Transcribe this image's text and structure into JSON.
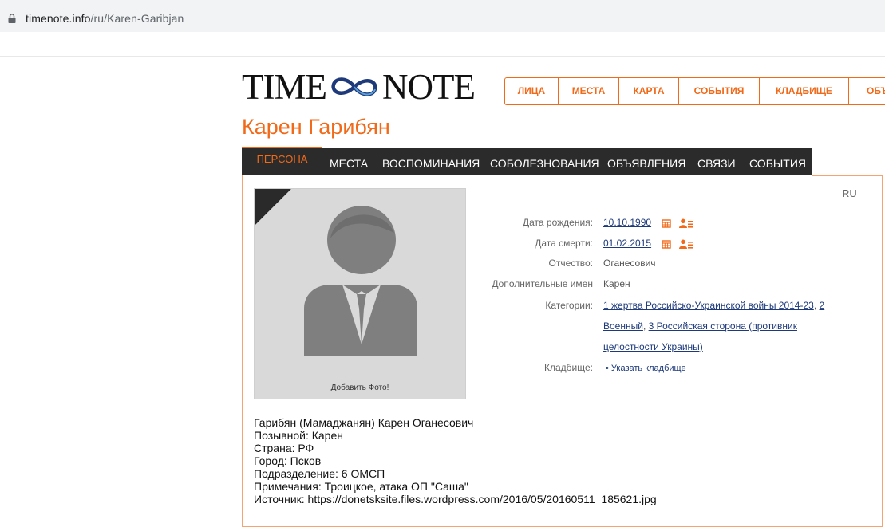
{
  "browser": {
    "url_domain": "timenote.info",
    "url_path": "/ru/Karen-Garibjan"
  },
  "logo": {
    "left": "TIME",
    "right": "NOTE"
  },
  "topnav": [
    "ЛИЦА",
    "МЕСТА",
    "КАРТА",
    "СОБЫТИЯ",
    "КЛАДБИЩЕ",
    "ОБЪ"
  ],
  "person": {
    "name": "Карен Гарибян"
  },
  "tabs": [
    "ПЕРСОНА",
    "МЕСТА",
    "ВОСПОМИНАНИЯ",
    "СОБОЛЕЗНОВАНИЯ",
    "ОБЪЯВЛЕНИЯ",
    "СВЯЗИ",
    "СОБЫТИЯ"
  ],
  "lang": "RU",
  "photo": {
    "add_label": "Добавить Фото!"
  },
  "details": {
    "birth_label": "Дата рождения:",
    "birth_value": "10.10.1990",
    "death_label": "Дата смерти:",
    "death_value": "01.02.2015",
    "patronymic_label": "Отчество:",
    "patronymic_value": "Оганесович",
    "extra_names_label": "Дополнительные имен",
    "extra_names_value": "Карен",
    "categories_label": "Категории:",
    "cat_1": "1 жертва Российско-Украинской войны 2014-23",
    "cat_sep": ",",
    "cat_2a": "2",
    "cat_2b": "Военный",
    "cat_3a": "3 Российская сторона (противник",
    "cat_3b": "целостности Украины)",
    "cemetery_label": "Кладбище:",
    "cemetery_value": "• Указать кладбище"
  },
  "bio": [
    "Гарибян (Мамаджанян) Карен Оганесович",
    "Позывной: Карен",
    "Страна: РФ",
    "Город: Псков",
    "Подразделение: 6 ОМСП",
    "Примечания: Троицкое, атака ОП \"Саша\"",
    "Источник: https://donetsksite.files.wordpress.com/2016/05/20160511_185621.jpg"
  ],
  "colors": {
    "accent": "#f06a1a",
    "link": "#1e3a7a",
    "tabs_bg": "#2b2b2b"
  },
  "icons": [
    "lock-icon",
    "calendar-icon",
    "person-list-icon",
    "infinity-icon",
    "avatar-placeholder-icon"
  ]
}
